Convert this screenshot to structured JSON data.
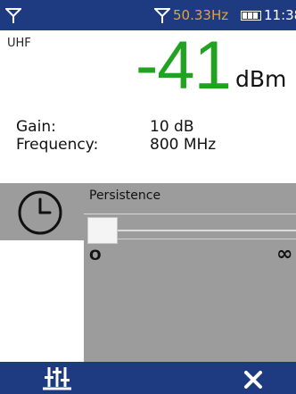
{
  "status_bar": {
    "frequency": "50.33Hz",
    "time": "11:38",
    "icons": [
      "antenna-icon",
      "antenna-icon",
      "battery-icon"
    ]
  },
  "measurement": {
    "band": "UHF",
    "level": "-41",
    "unit": "dBm",
    "gain_label": "Gain:",
    "gain_value": "10 dB",
    "frequency_label": "Frequency:",
    "frequency_value": "800 MHz",
    "colors": {
      "level": "#21a321"
    }
  },
  "persistence": {
    "title": "Persistence",
    "min_label": "O",
    "max_label": "∞",
    "slider_level": 0,
    "tab_icon": "clock-icon"
  },
  "bottom_bar": {
    "icons": [
      "sliders-icon",
      "close-icon"
    ]
  },
  "colors": {
    "bar_background": "#1e3a80",
    "frequency_text": "#e8a13a",
    "panel": "#9c9c9c"
  }
}
